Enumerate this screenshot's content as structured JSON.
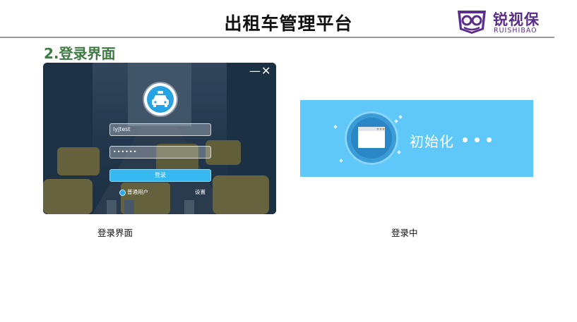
{
  "header": {
    "title": "出租车管理平台",
    "brand_cn": "锐视保",
    "brand_en": "RUISHIBAO",
    "brand_color": "#5b2d8c"
  },
  "section_title": "2.登录界面",
  "login_window": {
    "username_value": "lyjtest",
    "password_value": "••••••",
    "login_button": "登录",
    "user_type": "普通用户",
    "settings": "设置",
    "accent": "#36b8f0"
  },
  "init_panel": {
    "text": "初始化",
    "bg": "#5fc8f8"
  },
  "captions": {
    "left": "登录界面",
    "right": "登录中"
  }
}
